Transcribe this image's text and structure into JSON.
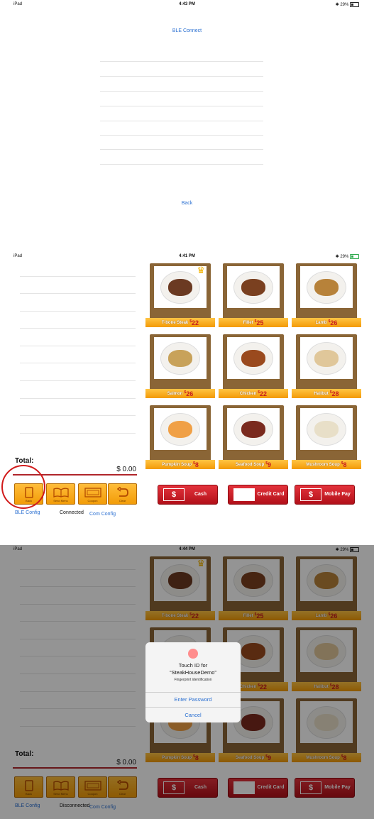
{
  "screen1": {
    "status": {
      "device": "iPad",
      "time": "4:43 PM",
      "battery": "29%"
    },
    "title": "BLE Connect",
    "back": "Back"
  },
  "screen2": {
    "status": {
      "device": "iPad",
      "time": "4:41 PM",
      "battery": "29%"
    },
    "total_label": "Total:",
    "total_value": "$ 0.00",
    "tools": [
      "Back",
      "Send Menu",
      "Coupon",
      "Clear"
    ],
    "payments": [
      "Cash",
      "Credit Card",
      "Mobile Pay"
    ],
    "ble_config": "BLE Config",
    "connection": "Connected",
    "com_config": "Com Config"
  },
  "screen3": {
    "status": {
      "device": "iPad",
      "time": "4:44 PM",
      "battery": "29%"
    },
    "total_label": "Total:",
    "total_value": "$ 0.00",
    "tools": [
      "Back",
      "Send Menu",
      "Coupon",
      "Clear"
    ],
    "payments": [
      "Cash",
      "Credit Card",
      "Mobile Pay"
    ],
    "ble_config": "BLE Config",
    "connection": "Disconnected",
    "com_config": "Com Config",
    "alert": {
      "title": "Touch ID for",
      "app": "“SteakHouseDemo”",
      "subtitle": "Fingerprint identification",
      "primary": "Enter Password",
      "cancel": "Cancel"
    }
  },
  "menu": [
    {
      "name": "T-bone Steak",
      "currency": "$",
      "price": "22",
      "best": true,
      "color": "#6b3a22"
    },
    {
      "name": "Fillet",
      "currency": "$",
      "price": "25",
      "best": false,
      "color": "#7a4020"
    },
    {
      "name": "Lamb",
      "currency": "$",
      "price": "26",
      "best": false,
      "color": "#b7823a"
    },
    {
      "name": "Salmon",
      "currency": "$",
      "price": "26",
      "best": false,
      "color": "#c8a25a"
    },
    {
      "name": "Chicken",
      "currency": "$",
      "price": "22",
      "best": false,
      "color": "#9a4a1e"
    },
    {
      "name": "Halibut",
      "currency": "$",
      "price": "28",
      "best": false,
      "color": "#e0c79a"
    },
    {
      "name": "Pumpkin Soup",
      "currency": "$",
      "price": "8",
      "best": false,
      "color": "#f0a046"
    },
    {
      "name": "Seafood Soup",
      "currency": "$",
      "price": "9",
      "best": false,
      "color": "#7a2a1e"
    },
    {
      "name": "Mushroom Soup",
      "currency": "$",
      "price": "8",
      "best": false,
      "color": "#e8dfc8"
    }
  ],
  "colors": {
    "link": "#2a6fd1",
    "accent_red": "#b0262b",
    "button_orange": "#f29c08"
  }
}
